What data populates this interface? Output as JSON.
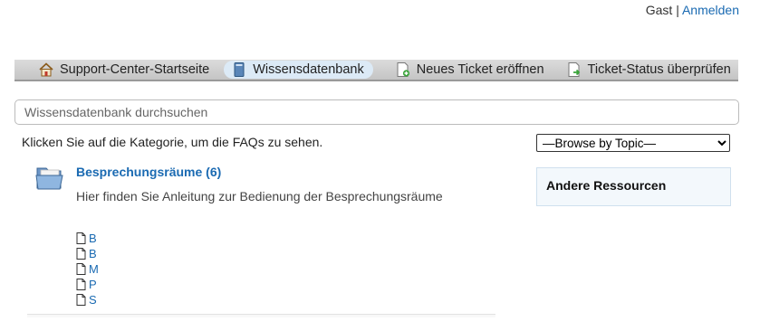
{
  "auth": {
    "guest_label": "Gast",
    "separator": "|",
    "login_label": "Anmelden"
  },
  "nav": {
    "items": [
      {
        "label": "Support-Center-Startseite",
        "icon": "home-icon"
      },
      {
        "label": "Wissensdatenbank",
        "icon": "kb-book-icon",
        "active": true
      },
      {
        "label": "Neues Ticket eröffnen",
        "icon": "new-ticket-icon"
      },
      {
        "label": "Ticket-Status überprüfen",
        "icon": "ticket-status-icon"
      }
    ]
  },
  "search": {
    "placeholder": "Wissensdatenbank durchsuchen",
    "value": ""
  },
  "instructions": "Klicken Sie auf die Kategorie, um die FAQs zu sehen.",
  "topic_select": {
    "selected": "—Browse by Topic—"
  },
  "sidebar": {
    "resources_title": "Andere Ressourcen"
  },
  "category": {
    "title": "Besprechungsräume (6)",
    "description": "Hier finden Sie Anleitung zur Bedienung der Besprechungsräume",
    "faqs": [
      {
        "label": "B"
      },
      {
        "label": "B"
      },
      {
        "label": "M"
      },
      {
        "label": "P"
      },
      {
        "label": "S"
      }
    ]
  },
  "colors": {
    "link": "#1a6ab2",
    "nav_bg": "#d0d0d0",
    "active_tab": "#dceaf6",
    "resources_bg": "#f3f8fc"
  }
}
